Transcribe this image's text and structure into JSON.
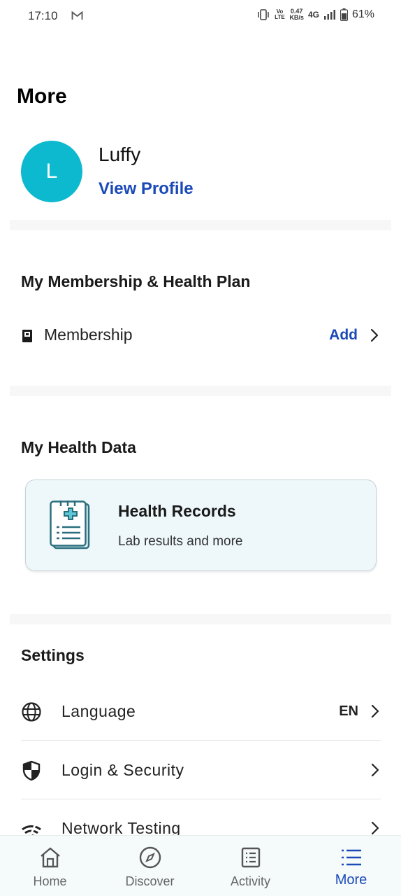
{
  "status_bar": {
    "time": "17:10",
    "volte": "Vo LTE",
    "speed_value": "0.47",
    "speed_unit": "KB/s",
    "network": "4G",
    "battery": "61%"
  },
  "page": {
    "title": "More"
  },
  "profile": {
    "initial": "L",
    "name": "Luffy",
    "view_profile": "View Profile",
    "avatar_color": "#0cb9cf"
  },
  "membership_section": {
    "title": "My Membership & Health Plan",
    "item": {
      "label": "Membership",
      "action": "Add",
      "icon": "id-card-icon"
    }
  },
  "health_data_section": {
    "title": "My Health Data",
    "card": {
      "title": "Health Records",
      "subtitle": "Lab results and more",
      "icon": "medical-record-icon"
    }
  },
  "settings_section": {
    "title": "Settings",
    "items": [
      {
        "label": "Language",
        "value": "EN",
        "icon": "globe-icon"
      },
      {
        "label": "Login & Security",
        "icon": "shield-icon"
      },
      {
        "label": "Network Testing",
        "icon": "wifi-icon"
      }
    ]
  },
  "bottom_nav": {
    "items": [
      {
        "label": "Home",
        "icon": "home-icon"
      },
      {
        "label": "Discover",
        "icon": "compass-icon"
      },
      {
        "label": "Activity",
        "icon": "list-doc-icon"
      },
      {
        "label": "More",
        "icon": "menu-list-icon",
        "active": true
      }
    ]
  },
  "colors": {
    "accent": "#1a49b8",
    "avatar": "#0cb9cf",
    "card_bg": "#eef8fb"
  }
}
